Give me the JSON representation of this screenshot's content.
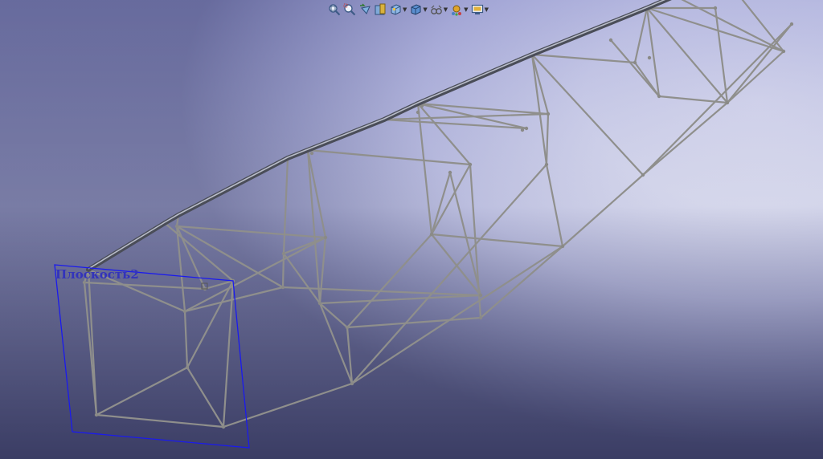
{
  "viewport": {
    "plane_label": "Плоскость2",
    "colors": {
      "truss": "#8f8f8c",
      "top_chord": "#4a4d58",
      "plane_outline": "#1a1aee",
      "plane_label": "#3333bb"
    }
  },
  "toolbar": {
    "buttons": [
      {
        "icon": "zoom-to-fit-icon",
        "has_dropdown": false
      },
      {
        "icon": "zoom-to-area-icon",
        "has_dropdown": false
      },
      {
        "icon": "previous-view-icon",
        "has_dropdown": false
      },
      {
        "icon": "section-view-icon",
        "has_dropdown": false
      },
      {
        "icon": "view-orientation-icon",
        "has_dropdown": true
      },
      {
        "icon": "display-style-icon",
        "has_dropdown": true
      },
      {
        "icon": "hide-show-items-icon",
        "has_dropdown": true
      },
      {
        "icon": "edit-appearance-icon",
        "has_dropdown": true
      },
      {
        "icon": "view-settings-icon",
        "has_dropdown": true
      }
    ]
  }
}
